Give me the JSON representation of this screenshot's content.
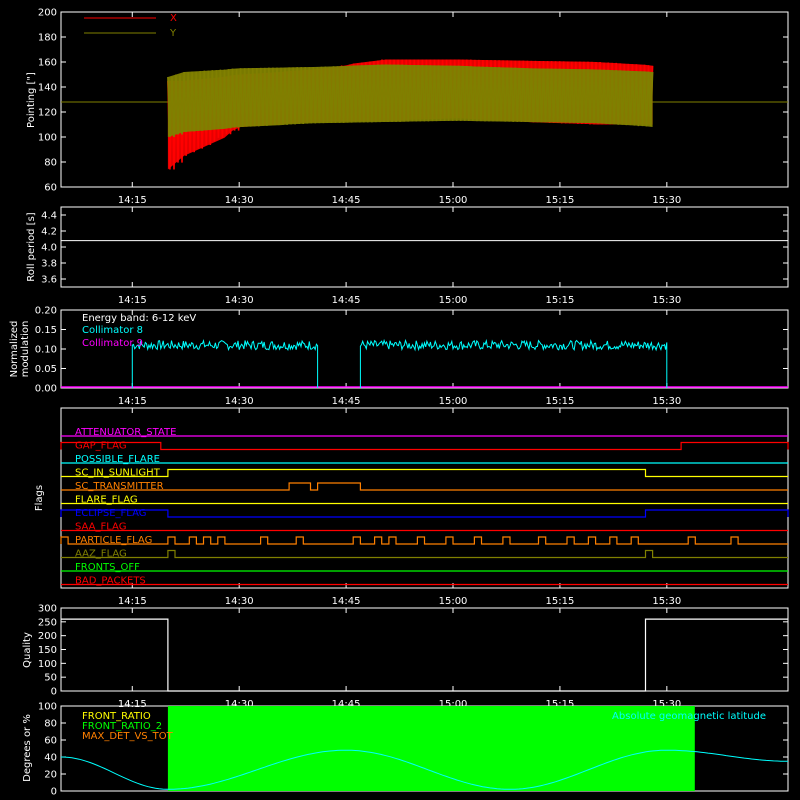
{
  "figure": {
    "x_ticks": [
      "14:15",
      "14:30",
      "14:45",
      "15:00",
      "15:15",
      "15:30"
    ]
  },
  "chart_data": [
    {
      "type": "line",
      "ylabel": "Pointing [\"]",
      "ylim": [
        60,
        200
      ],
      "yticks": [
        "60",
        "80",
        "100",
        "120",
        "140",
        "160",
        "180",
        "200"
      ],
      "xlim": [
        "14:05",
        "15:47"
      ],
      "legend": [
        "X",
        "Y"
      ],
      "colors": {
        "X": "#ff0000",
        "Y": "#808000"
      },
      "baseline": 128,
      "series": [
        {
          "name": "X",
          "x": [
            "14:20",
            "14:22",
            "14:30",
            "14:40",
            "14:50",
            "15:00",
            "15:10",
            "15:20",
            "15:28"
          ],
          "upper": [
            145,
            145,
            150,
            154,
            162,
            162,
            161,
            160,
            157
          ],
          "lower": [
            74,
            85,
            108,
            112,
            113,
            115,
            112,
            110,
            110
          ]
        },
        {
          "name": "Y",
          "x": [
            "14:20",
            "14:22",
            "14:30",
            "14:40",
            "14:50",
            "15:00",
            "15:10",
            "15:20",
            "15:28"
          ],
          "upper": [
            148,
            152,
            155,
            156,
            158,
            157,
            155,
            154,
            152
          ],
          "lower": [
            100,
            104,
            108,
            111,
            112,
            113,
            112,
            111,
            108
          ]
        }
      ]
    },
    {
      "type": "line",
      "ylabel": "Roll period [s]",
      "ylim": [
        3.5,
        4.5
      ],
      "yticks": [
        "3.6",
        "3.8",
        "4.0",
        "4.2",
        "4.4"
      ],
      "series": [
        {
          "name": "",
          "x": [
            "14:05",
            "15:47"
          ],
          "values": [
            4.08,
            4.08
          ]
        }
      ]
    },
    {
      "type": "line",
      "ylabel": "Normalized modulation",
      "ylim": [
        0,
        0.2
      ],
      "yticks": [
        "0.00",
        "0.05",
        "0.10",
        "0.15",
        "0.20"
      ],
      "annotation": "Energy band: 6-12 keV",
      "legend": [
        "Collimator 8",
        "Collimator 9"
      ],
      "colors": {
        "Collimator 8": "#00ffff",
        "Collimator 9": "#ff00ff"
      },
      "series": [
        {
          "name": "Collimator 8",
          "segments": [
            [
              "14:15",
              "14:41"
            ],
            [
              "14:47",
              "15:30"
            ]
          ],
          "level": 0.11,
          "noise": 0.012
        },
        {
          "name": "Collimator 9",
          "x": [
            "14:05",
            "15:47"
          ],
          "values": [
            0,
            0
          ]
        }
      ]
    },
    {
      "type": "line",
      "ylabel": "Flags",
      "flags": [
        {
          "name": "ATTENUATOR_STATE",
          "color": "#ff00ff",
          "on": []
        },
        {
          "name": "GAP_FLAG",
          "color": "#ff0000",
          "on": [
            [
              "14:05",
              "14:19"
            ],
            [
              "15:32",
              "15:47"
            ]
          ]
        },
        {
          "name": "POSSIBLE_FLARE",
          "color": "#00ffff",
          "on": []
        },
        {
          "name": "SC_IN_SUNLIGHT",
          "color": "#ffff00",
          "on": [
            [
              "14:20",
              "15:27"
            ]
          ]
        },
        {
          "name": "SC_TRANSMITTER",
          "color": "#ff8000",
          "on": [
            [
              "14:37",
              "14:40"
            ],
            [
              "14:41",
              "14:47"
            ]
          ]
        },
        {
          "name": "FLARE_FLAG",
          "color": "#ffff00",
          "on": []
        },
        {
          "name": "ECLIPSE_FLAG",
          "color": "#0000ff",
          "on": [
            [
              "14:05",
              "14:20"
            ],
            [
              "15:27",
              "15:47"
            ]
          ]
        },
        {
          "name": "SAA_FLAG",
          "color": "#ff0000",
          "on": []
        },
        {
          "name": "PARTICLE_FLAG",
          "color": "#ff8000",
          "on": [
            [
              "14:05",
              "14:06"
            ],
            [
              "14:20",
              "14:21"
            ],
            [
              "14:23",
              "14:24"
            ],
            [
              "14:25",
              "14:26"
            ],
            [
              "14:27",
              "14:28"
            ],
            [
              "14:33",
              "14:34"
            ],
            [
              "14:38",
              "14:39"
            ],
            [
              "14:46",
              "14:47"
            ],
            [
              "14:49",
              "14:50"
            ],
            [
              "14:51",
              "14:52"
            ],
            [
              "14:55",
              "14:56"
            ],
            [
              "14:59",
              "15:00"
            ],
            [
              "15:03",
              "15:04"
            ],
            [
              "15:07",
              "15:08"
            ],
            [
              "15:12",
              "15:13"
            ],
            [
              "15:16",
              "15:17"
            ],
            [
              "15:19",
              "15:20"
            ],
            [
              "15:22",
              "15:23"
            ],
            [
              "15:25",
              "15:26"
            ],
            [
              "15:33",
              "15:34"
            ],
            [
              "15:39",
              "15:40"
            ]
          ]
        },
        {
          "name": "AAZ_FLAG",
          "color": "#808000",
          "on": [
            [
              "14:20",
              "14:21"
            ],
            [
              "15:27",
              "15:28"
            ]
          ]
        },
        {
          "name": "FRONTS_OFF",
          "color": "#00ff00",
          "on": []
        },
        {
          "name": "BAD_PACKETS",
          "color": "#ff0000",
          "on": []
        }
      ]
    },
    {
      "type": "line",
      "ylabel": "Quality",
      "ylim": [
        0,
        300
      ],
      "yticks": [
        "0",
        "50",
        "100",
        "150",
        "200",
        "250",
        "300"
      ],
      "series": [
        {
          "name": "",
          "x": [
            "14:05",
            "14:20",
            "14:20",
            "15:27",
            "15:27",
            "15:47"
          ],
          "values": [
            260,
            260,
            0,
            0,
            260,
            260
          ]
        }
      ]
    },
    {
      "type": "line",
      "ylabel": "Degrees or %",
      "ylim": [
        0,
        100
      ],
      "yticks": [
        "0",
        "20",
        "40",
        "60",
        "80",
        "100"
      ],
      "legend": [
        "FRONT_RATIO",
        "FRONT_RATIO_2",
        "MAX_DET_VS_TOT"
      ],
      "colors": {
        "FRONT_RATIO": "#ffff00",
        "FRONT_RATIO_2": "#00ff00",
        "MAX_DET_VS_TOT": "#ff8000",
        "Absolute geomagnetic latitude": "#00ffff"
      },
      "right_label": "Absolute geomagnetic latitude",
      "series": [
        {
          "name": "Absolute geomagnetic latitude",
          "x": [
            "14:05",
            "14:20",
            "14:45",
            "15:08",
            "15:30",
            "15:47"
          ],
          "values": [
            40,
            2,
            48,
            2,
            48,
            35
          ]
        },
        {
          "name": "FRONT_RATIO_2",
          "segments": [
            [
              "14:20",
              "15:30"
            ]
          ],
          "level": 100
        }
      ]
    }
  ]
}
